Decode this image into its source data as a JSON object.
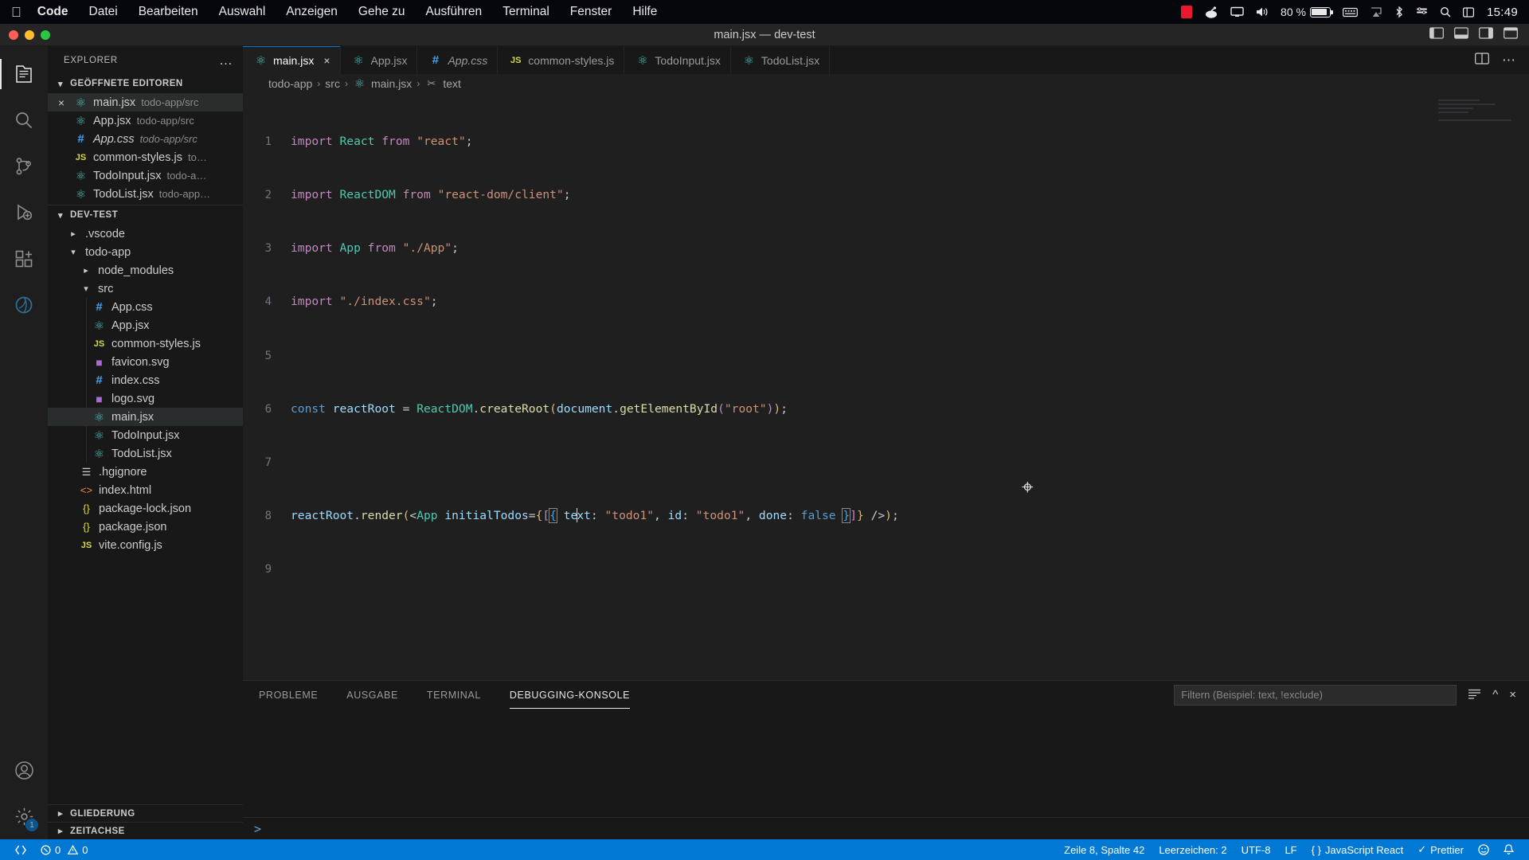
{
  "macbar": {
    "apple_icon": "apple-icon",
    "items": [
      {
        "label": "Code",
        "bold": true
      },
      {
        "label": "Datei",
        "bold": false
      },
      {
        "label": "Bearbeiten",
        "bold": false
      },
      {
        "label": "Auswahl",
        "bold": false
      },
      {
        "label": "Anzeigen",
        "bold": false
      },
      {
        "label": "Gehe zu",
        "bold": false
      },
      {
        "label": "Ausführen",
        "bold": false
      },
      {
        "label": "Terminal",
        "bold": false
      },
      {
        "label": "Fenster",
        "bold": false
      },
      {
        "label": "Hilfe",
        "bold": false
      }
    ],
    "battery_percent": "80 %",
    "clock": "15:49",
    "status_icons": [
      "record-icon",
      "shield-icon",
      "display-icon",
      "volume-icon",
      "battery-icon",
      "keyboard-icon",
      "airplay-icon",
      "bluetooth-icon",
      "control-center-icon",
      "search-icon",
      "menu-icon"
    ]
  },
  "titlebar": {
    "title": "main.jsx — dev-test",
    "traffic_lights": [
      "close-button",
      "minimize-button",
      "zoom-button"
    ]
  },
  "activitybar": {
    "items": [
      {
        "name": "explorer",
        "icon": "files-icon",
        "active": true,
        "badge": null
      },
      {
        "name": "search",
        "icon": "search-icon",
        "active": false,
        "badge": null
      },
      {
        "name": "source-control",
        "icon": "source-control-icon",
        "active": false,
        "badge": null
      },
      {
        "name": "run-and-debug",
        "icon": "run-debug-icon",
        "active": false,
        "badge": null
      },
      {
        "name": "extensions",
        "icon": "extensions-icon",
        "active": false,
        "badge": null
      },
      {
        "name": "azure",
        "icon": "azure-icon",
        "active": false,
        "badge": null
      }
    ],
    "bottom": [
      {
        "name": "accounts",
        "icon": "account-icon",
        "badge": null
      },
      {
        "name": "manage",
        "icon": "gear-icon",
        "badge": "1"
      }
    ]
  },
  "sidebar": {
    "header": "EXPLORER",
    "more_actions": "…",
    "opened_editors": {
      "title": "GEÖFFNETE EDITOREN",
      "expanded": true,
      "items": [
        {
          "name": "main.jsx",
          "path": "todo-app/src",
          "icon": "react-icon",
          "selected": true,
          "italic": false,
          "closeable": true
        },
        {
          "name": "App.jsx",
          "path": "todo-app/src",
          "icon": "react-icon",
          "selected": false,
          "italic": false,
          "closeable": false
        },
        {
          "name": "App.css",
          "path": "todo-app/src",
          "icon": "css-icon",
          "selected": false,
          "italic": true,
          "closeable": false
        },
        {
          "name": "common-styles.js",
          "path": "to…",
          "icon": "js-icon",
          "selected": false,
          "italic": false,
          "closeable": false
        },
        {
          "name": "TodoInput.jsx",
          "path": "todo-a…",
          "icon": "react-icon",
          "selected": false,
          "italic": false,
          "closeable": false
        },
        {
          "name": "TodoList.jsx",
          "path": "todo-app…",
          "icon": "react-icon",
          "selected": false,
          "italic": false,
          "closeable": false
        }
      ]
    },
    "workspace": {
      "title": "DEV-TEST",
      "expanded": true,
      "tree": [
        {
          "label": ".vscode",
          "type": "folder",
          "indent": 1,
          "expanded": false,
          "icon": "chevron-right-icon"
        },
        {
          "label": "todo-app",
          "type": "folder",
          "indent": 1,
          "expanded": true,
          "icon": "chevron-down-icon"
        },
        {
          "label": "node_modules",
          "type": "folder",
          "indent": 2,
          "expanded": false,
          "icon": "chevron-right-icon"
        },
        {
          "label": "src",
          "type": "folder",
          "indent": 2,
          "expanded": true,
          "icon": "chevron-down-icon"
        },
        {
          "label": "App.css",
          "type": "file",
          "indent": 3,
          "icon": "css-icon"
        },
        {
          "label": "App.jsx",
          "type": "file",
          "indent": 3,
          "icon": "react-icon"
        },
        {
          "label": "common-styles.js",
          "type": "file",
          "indent": 3,
          "icon": "js-icon"
        },
        {
          "label": "favicon.svg",
          "type": "file",
          "indent": 3,
          "icon": "svg-icon"
        },
        {
          "label": "index.css",
          "type": "file",
          "indent": 3,
          "icon": "css-icon"
        },
        {
          "label": "logo.svg",
          "type": "file",
          "indent": 3,
          "icon": "svg-icon"
        },
        {
          "label": "main.jsx",
          "type": "file",
          "indent": 3,
          "icon": "react-icon",
          "selected": true
        },
        {
          "label": "TodoInput.jsx",
          "type": "file",
          "indent": 3,
          "icon": "react-icon"
        },
        {
          "label": "TodoList.jsx",
          "type": "file",
          "indent": 3,
          "icon": "react-icon"
        },
        {
          "label": ".hgignore",
          "type": "file",
          "indent": 2,
          "icon": "hg-icon"
        },
        {
          "label": "index.html",
          "type": "file",
          "indent": 2,
          "icon": "html-icon"
        },
        {
          "label": "package-lock.json",
          "type": "file",
          "indent": 2,
          "icon": "json-icon"
        },
        {
          "label": "package.json",
          "type": "file",
          "indent": 2,
          "icon": "json-icon"
        },
        {
          "label": "vite.config.js",
          "type": "file",
          "indent": 2,
          "icon": "js-icon"
        }
      ]
    },
    "collapsed_sections": [
      {
        "title": "GLIEDERUNG"
      },
      {
        "title": "ZEITACHSE"
      }
    ]
  },
  "tabs": {
    "items": [
      {
        "label": "main.jsx",
        "icon": "react-icon",
        "active": true,
        "italic": false,
        "close": "×"
      },
      {
        "label": "App.jsx",
        "icon": "react-icon",
        "active": false,
        "italic": false
      },
      {
        "label": "App.css",
        "icon": "css-icon",
        "active": false,
        "italic": true
      },
      {
        "label": "common-styles.js",
        "icon": "js-icon",
        "active": false,
        "italic": false
      },
      {
        "label": "TodoInput.jsx",
        "icon": "react-icon",
        "active": false,
        "italic": false
      },
      {
        "label": "TodoList.jsx",
        "icon": "react-icon",
        "active": false,
        "italic": false
      }
    ],
    "actions": [
      "split-editor-icon",
      "more-actions-icon"
    ]
  },
  "breadcrumb": {
    "parts": [
      "todo-app",
      "src",
      "main.jsx",
      "text"
    ],
    "separator": "›",
    "file_icon": "react-icon",
    "symbol_icon": "wrench-icon"
  },
  "editor": {
    "lines": [
      {
        "num": "1",
        "text": "import React from \"react\";"
      },
      {
        "num": "2",
        "text": "import ReactDOM from \"react-dom/client\";"
      },
      {
        "num": "3",
        "text": "import App from \"./App\";"
      },
      {
        "num": "4",
        "text": "import \"./index.css\";"
      },
      {
        "num": "5",
        "text": ""
      },
      {
        "num": "6",
        "text": "const reactRoot = ReactDOM.createRoot(document.getElementById(\"root\"));"
      },
      {
        "num": "7",
        "text": ""
      },
      {
        "num": "8",
        "text": "reactRoot.render(<App initialTodos={[{ text: \"todo1\", id: \"todo1\", done: false }]} />);"
      },
      {
        "num": "9",
        "text": ""
      }
    ]
  },
  "panel": {
    "tabs": [
      {
        "label": "PROBLEME",
        "active": false
      },
      {
        "label": "AUSGABE",
        "active": false
      },
      {
        "label": "TERMINAL",
        "active": false
      },
      {
        "label": "DEBUGGING-KONSOLE",
        "active": true
      }
    ],
    "filter_placeholder": "Filtern (Beispiel: text, !exclude)",
    "filter_value": "",
    "actions": [
      "clear-console-icon",
      "chevron-up-icon",
      "close-icon"
    ],
    "repl_prompt": ">"
  },
  "statusbar": {
    "remote_icon": "remote-window-icon",
    "errors": "0",
    "warnings": "0",
    "cursor_position": "Zeile 8, Spalte 42",
    "indentation": "Leerzeichen: 2",
    "encoding": "UTF-8",
    "eol": "LF",
    "language": "JavaScript React",
    "language_icon": "braces-icon",
    "formatter": "Prettier",
    "formatter_icon": "check-icon",
    "notifications_icon": "bell-icon",
    "feedback_icon": "smiley-icon"
  },
  "colors": {
    "accent": "#0078d4",
    "statusbar_bg": "#0078d4",
    "editor_bg": "#1f1f1f",
    "sidebar_bg": "#181818"
  }
}
